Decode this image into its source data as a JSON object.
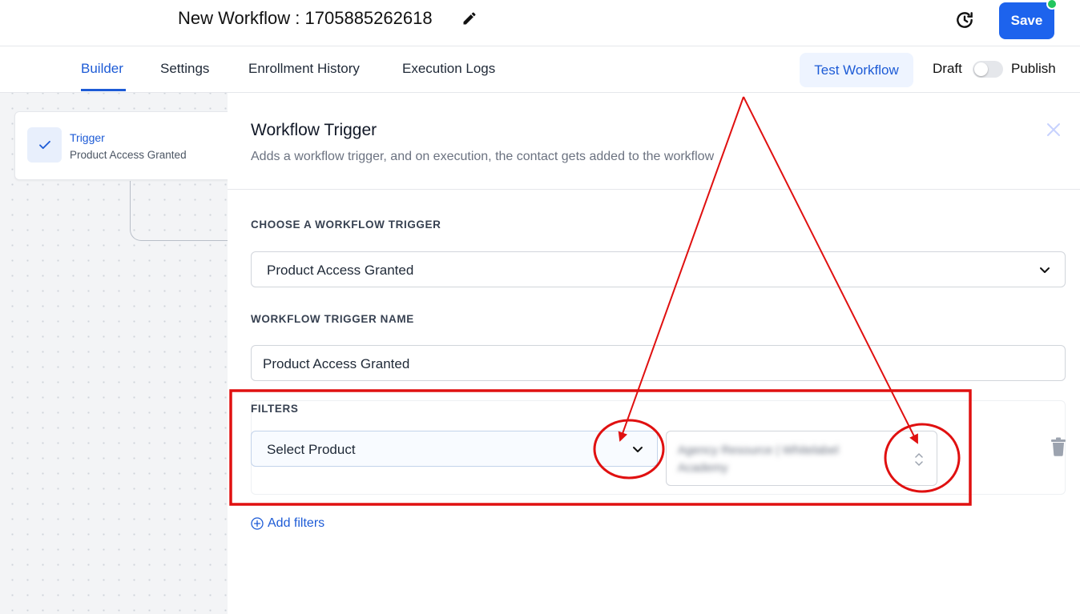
{
  "header": {
    "workflow_title": "New Workflow : 1705885262618",
    "save_label": "Save"
  },
  "tabs": [
    {
      "label": "Builder",
      "active": true
    },
    {
      "label": "Settings"
    },
    {
      "label": "Enrollment History"
    },
    {
      "label": "Execution Logs"
    }
  ],
  "toolbar": {
    "test_label": "Test Workflow",
    "draft_label": "Draft",
    "publish_label": "Publish",
    "published": false
  },
  "canvas": {
    "trigger_card": {
      "title": "Trigger",
      "subtitle": "Product Access Granted"
    }
  },
  "panel": {
    "title": "Workflow Trigger",
    "subtitle": "Adds a workflow trigger, and on execution, the contact gets added to the workflow",
    "choose_label": "CHOOSE A WORKFLOW TRIGGER",
    "selected_trigger": "Product Access Granted",
    "name_label": "WORKFLOW TRIGGER NAME",
    "trigger_name_value": "Product Access Granted",
    "filters_label": "FILTERS",
    "filter_field": "Select Product",
    "filter_value_blurred": "Agency Resource | Whitelabel Academy",
    "add_filters_label": "Add filters"
  },
  "colors": {
    "accent": "#1d63ed",
    "link": "#1d5bd6",
    "status_dot": "#22c55e",
    "annotation": "#e01010"
  },
  "icons": [
    "edit-pencil-icon",
    "history-clock-icon",
    "check-icon",
    "close-icon",
    "chevron-down-icon",
    "updown-chevron-icon",
    "trash-icon",
    "plus-circle-icon"
  ]
}
